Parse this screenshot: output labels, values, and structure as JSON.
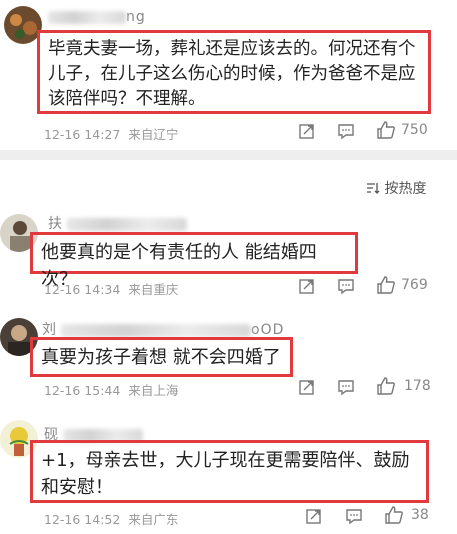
{
  "comments": [
    {
      "name_visible": "g",
      "name_suffix": "ng",
      "text": "毕竟夫妻一场，葬礼还是应该去的。何况还有个儿子，在儿子这么伤心的时候，作为爸爸不是应该陪伴吗？不理解。",
      "time": "12-16 14:27",
      "location": "来自辽宁",
      "likes": "750"
    },
    {
      "name_visible": "扶",
      "name_suffix": "",
      "text": "他要真的是个有责任的人 能结婚四次？",
      "time": "12-16 14:34",
      "location": "来自重庆",
      "likes": "769"
    },
    {
      "name_visible": "刘",
      "name_suffix": "oOD",
      "text": "真要为孩子着想 就不会四婚了",
      "time": "12-16 15:44",
      "location": "来自上海",
      "likes": "178"
    },
    {
      "name_visible": "砚",
      "name_suffix": "",
      "text": "+1，母亲去世，大儿子现在更需要陪伴、鼓励和安慰！",
      "time": "12-16 14:52",
      "location": "来自广东",
      "likes": "38"
    }
  ],
  "sort": {
    "label": "按热度"
  },
  "icons": {
    "share": "share-icon",
    "comment": "comment-icon",
    "like": "thumbs-up-icon",
    "sort": "sort-icon"
  },
  "colors": {
    "highlight": "#e03a3e",
    "meta": "#999999"
  }
}
